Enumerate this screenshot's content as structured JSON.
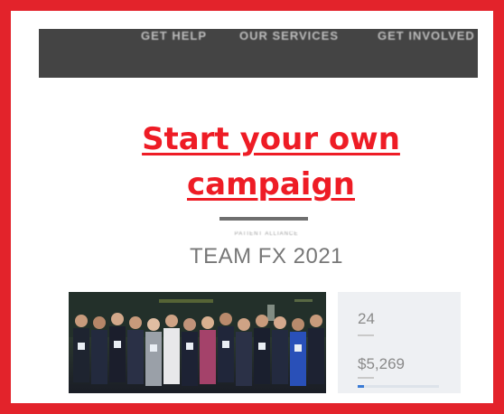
{
  "nav": {
    "items": [
      "GET HELP",
      "OUR SERVICES",
      "GET INVOLVED"
    ]
  },
  "campaign": {
    "link_line1": "Start your own",
    "link_line2": "campaign"
  },
  "team": {
    "eyebrow": "PATIENT ALLIANCE",
    "title": "TEAM FX 2021"
  },
  "stats": {
    "count": "24",
    "amount": "$5,269",
    "progress_fraction": 0.08
  },
  "colors": {
    "frame": "#e3232b",
    "link": "#ee1c25",
    "navbar": "#444444"
  }
}
